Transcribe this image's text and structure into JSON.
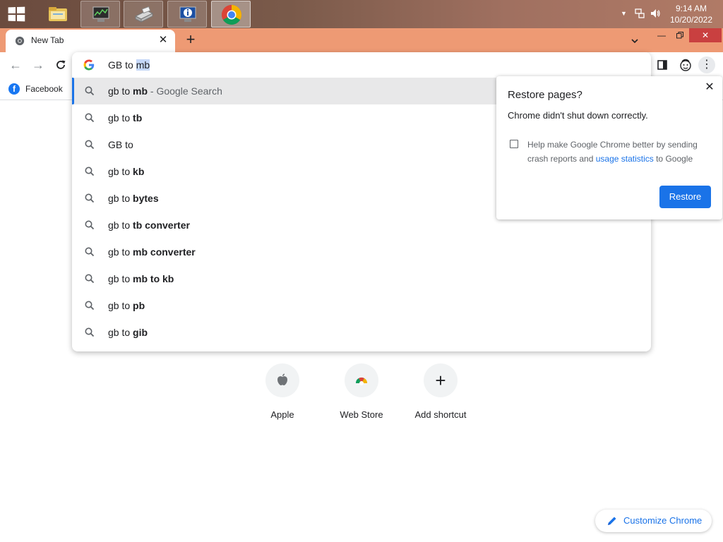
{
  "taskbar": {
    "apps": [
      "file-explorer",
      "system-monitor",
      "scanner",
      "info-app",
      "google-chrome"
    ],
    "time": "9:14 AM",
    "date": "10/20/2022"
  },
  "tabs": [
    {
      "title": "New Tab",
      "active": true
    }
  ],
  "toolbar": {
    "omnibox_typed": "GB to ",
    "omnibox_selected": "mb"
  },
  "bookmarks": [
    {
      "label": "Facebook",
      "icon": "facebook-icon"
    }
  ],
  "suggestions": [
    {
      "prefix": "gb to ",
      "bold": "mb",
      "hint": " - Google Search",
      "active": true
    },
    {
      "prefix": "gb to ",
      "bold": "tb",
      "hint": ""
    },
    {
      "prefix": "GB to",
      "bold": "",
      "hint": ""
    },
    {
      "prefix": "gb to ",
      "bold": "kb",
      "hint": ""
    },
    {
      "prefix": "gb to ",
      "bold": "bytes",
      "hint": ""
    },
    {
      "prefix": "gb to ",
      "bold": "tb converter",
      "hint": ""
    },
    {
      "prefix": "gb to ",
      "bold": "mb converter",
      "hint": ""
    },
    {
      "prefix": "gb to ",
      "bold": "mb to kb",
      "hint": ""
    },
    {
      "prefix": "gb to ",
      "bold": "pb",
      "hint": ""
    },
    {
      "prefix": "gb to ",
      "bold": "gib",
      "hint": ""
    }
  ],
  "restore": {
    "title": "Restore pages?",
    "message": "Chrome didn't shut down correctly.",
    "help_before": "Help make Google Chrome better by sending crash reports and ",
    "help_link": "usage statistics",
    "help_after": " to Google",
    "checkbox_checked": false,
    "button": "Restore"
  },
  "shortcuts": [
    {
      "label": "Apple",
      "icon": "apple-icon"
    },
    {
      "label": "Web Store",
      "icon": "web-store-icon"
    },
    {
      "label": "Add shortcut",
      "icon": "plus-icon"
    }
  ],
  "customize": {
    "label": "Customize Chrome"
  },
  "colors": {
    "accent": "#1a73e8",
    "tabstrip": "#ee9a74",
    "active_suggestion": "#e8e8e9",
    "selection": "#c5d8f8",
    "close_button": "#c94040"
  }
}
